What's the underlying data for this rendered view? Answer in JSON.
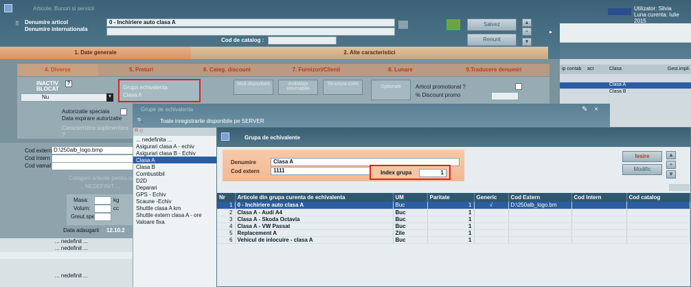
{
  "app": {
    "title": "Articole, Bunuri si servicii",
    "user": "Utilizator: Silvia",
    "period": "Luna curenta: Iulie 2015"
  },
  "header": {
    "denumire_label": "Denumire articol",
    "denumire_value": "0 - Inchiriere auto clasa A",
    "intl_label": "Denumire internationala",
    "catalog_label": "Cod de catalog :",
    "save": "Salvez",
    "cancel": "Renunt"
  },
  "main_tabs": [
    "1. Date generale",
    "2. Alte caracteristici"
  ],
  "sub_tabs": [
    "4. Diverse",
    "5. Preturi",
    "6. Categ. discount",
    "7. Furnizori/Clienti",
    "8. Lunare",
    "9.Traducere denumiri"
  ],
  "diverse": {
    "inactiv": "INACTIV",
    "blocat": "BLOCAT",
    "blocat_value": "Nu",
    "grupa_label": "Grupa echivalenta",
    "grupa_value": "Clasa A",
    "mod": "Mod depozitare",
    "ambalaje": "Ambalaje returnabile",
    "structura": "Structura colet",
    "optionale": "Optionale",
    "promo": "Articol promotional ?",
    "discount": "% Discount promo",
    "autorizatie": "Autorizatie speciala",
    "data_exp": "Data expirare autorizatie",
    "caract": "Caracteristica suplimentara",
    "caract_q": "?",
    "cod_extern_label": "Cod extern",
    "cod_extern_value": "D:\\250alb_logo.bmp",
    "cod_intern_label": "Cod intern",
    "cod_vamal_label": "Cod vamal",
    "categ": "Categorii articole pentru ca",
    "nedefinit": "... NEDEFINIT ...",
    "masa": "Masa:",
    "masa_u": "kg",
    "volum": "Volum:",
    "volum_u": "cc",
    "greut": "Greut.spec.",
    "data_ad": "Data adaugarii",
    "data_ad_v": "12.10.2",
    "left_list": [
      "... nedefinit ...",
      "... nedefinit ...",
      "",
      "",
      "... nedefinit ..."
    ]
  },
  "right_panel": {
    "cols": [
      "ip contab",
      "act",
      "Clasa",
      "Gest.impli"
    ],
    "rows": [
      "Clasa A",
      "Clasa B"
    ]
  },
  "grupe": {
    "title": "Grupe de echivalenta",
    "toolbar": "Toate inregistrarile disponibile pe SERVER",
    "items": [
      "... nedefinita ...",
      "Asigurari clasa A - echiv",
      "Asigurari clasa B - Echiv",
      "Clasa A",
      "Clasa B",
      "Combustibil",
      "D2D",
      "Deparari",
      "GPS - Echiv",
      "Scaune -Echiv",
      "Shuttle clasa A km",
      "Shuttle extern clasa A - ore",
      "Valoare fixa"
    ],
    "selected": 3
  },
  "dialog": {
    "title": "Grupa de echivalente",
    "denumire_label": "Denumire",
    "denumire_value": "Clasa A",
    "cod_label": "Cod extern",
    "cod_value": "1111",
    "index_label": "Index grupa",
    "index_value": "1",
    "iesire": "Iesire",
    "modific": "Modific",
    "columns": [
      "Nr",
      "Articole din grupa curenta de echivalenta",
      "UM",
      "Paritate",
      "Generic",
      "Cod Extern",
      "Cod Intern",
      "Cod catalog"
    ],
    "rows": [
      [
        "1",
        "0 - Inchiriere auto clasa A",
        "Buc",
        "1",
        "√",
        "D:\\250alb_logo.bm",
        "",
        ""
      ],
      [
        "2",
        "Clasa A - Audi A4",
        "Buc",
        "1",
        "",
        "",
        "",
        ""
      ],
      [
        "3",
        "Clasa A - Skoda Octavia",
        "Buc",
        "1",
        "",
        "",
        "",
        ""
      ],
      [
        "4",
        "Clasa A - VW Passat",
        "Buc",
        "1",
        "",
        "",
        "",
        ""
      ],
      [
        "5",
        "Replacement A",
        "Zile",
        "1",
        "",
        "",
        "",
        ""
      ],
      [
        "6",
        "Vehicul de inlocuire - clasa A",
        "Buc",
        "1",
        "",
        "",
        "",
        ""
      ]
    ]
  }
}
